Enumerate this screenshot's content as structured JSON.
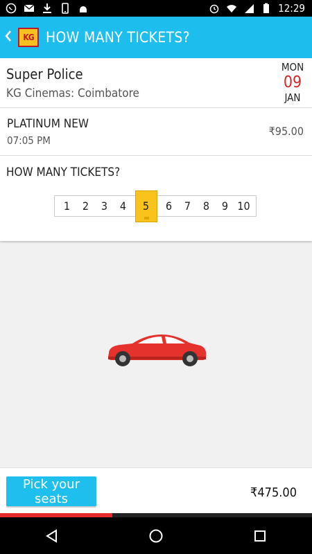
{
  "status": {
    "time": "12:29"
  },
  "appbar": {
    "back_icon": "chevron-left-icon",
    "logo_text": "KG",
    "title": "HOW MANY TICKETS?"
  },
  "movie": {
    "name": "Super Police",
    "cinema": "KG Cinemas: Coimbatore"
  },
  "date": {
    "dow": "MON",
    "day": "09",
    "month": "JAN"
  },
  "show": {
    "screen": "PLATINUM NEW",
    "time": "07:05 PM",
    "price": "₹95.00"
  },
  "ticket_picker": {
    "question": "HOW MANY TICKETS?",
    "counts": [
      "1",
      "2",
      "3",
      "4",
      "5",
      "6",
      "7",
      "8",
      "9",
      "10"
    ],
    "selected": "5"
  },
  "footer": {
    "cta": "Pick your seats",
    "total": "₹475.00"
  },
  "progress": {
    "fraction": 0.36
  },
  "colors": {
    "accent": "#1dbdee",
    "selected": "#f8c31a",
    "date_day": "#d12a2a",
    "progress": "#e42a2a"
  }
}
